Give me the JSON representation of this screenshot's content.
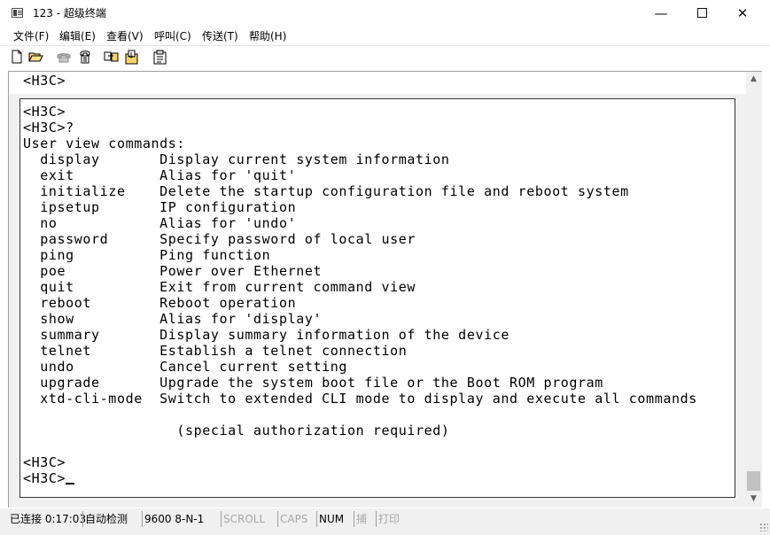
{
  "window": {
    "title": "123 - 超级终端",
    "minimize_glyph": "—",
    "close_glyph": "✕"
  },
  "menu": [
    "文件(F)",
    "编辑(E)",
    "查看(V)",
    "呼叫(C)",
    "传送(T)",
    "帮助(H)"
  ],
  "toolbar": {
    "icons": [
      "new-file-icon",
      "open-folder-icon",
      "call-icon",
      "disconnect-icon",
      "send-icon",
      "receive-icon",
      "properties-icon"
    ]
  },
  "terminal": {
    "top_line": "<H3C>",
    "prompt_lines": [
      "<H3C>",
      "<H3C>?"
    ],
    "header": "User view commands:",
    "commands": [
      {
        "cmd": "display",
        "desc": "Display current system information"
      },
      {
        "cmd": "exit",
        "desc": "Alias for 'quit'"
      },
      {
        "cmd": "initialize",
        "desc": "Delete the startup configuration file and reboot system"
      },
      {
        "cmd": "ipsetup",
        "desc": "IP configuration"
      },
      {
        "cmd": "no",
        "desc": "Alias for 'undo'"
      },
      {
        "cmd": "password",
        "desc": "Specify password of local user"
      },
      {
        "cmd": "ping",
        "desc": "Ping function"
      },
      {
        "cmd": "poe",
        "desc": "Power over Ethernet"
      },
      {
        "cmd": "quit",
        "desc": "Exit from current command view"
      },
      {
        "cmd": "reboot",
        "desc": "Reboot operation"
      },
      {
        "cmd": "show",
        "desc": "Alias for 'display'"
      },
      {
        "cmd": "summary",
        "desc": "Display summary information of the device"
      },
      {
        "cmd": "telnet",
        "desc": "Establish a telnet connection"
      },
      {
        "cmd": "undo",
        "desc": "Cancel current setting"
      },
      {
        "cmd": "upgrade",
        "desc": "Upgrade the system boot file or the Boot ROM program"
      },
      {
        "cmd": "xtd-cli-mode",
        "desc": "Switch to extended CLI mode to display and execute all commands"
      }
    ],
    "continuation": "(special authorization required)",
    "tail_lines": [
      "<H3C>",
      "<H3C>"
    ]
  },
  "status": {
    "connection": "已连接 0:17:03",
    "detect": "自动检测",
    "baud": "9600 8-N-1",
    "scroll": "SCROLL",
    "caps": "CAPS",
    "num": "NUM",
    "capture": "捕",
    "print": "打印"
  },
  "colors": {
    "window_bg": "#ffffff",
    "chrome_bg": "#f0f0f0",
    "dim_text": "#a8a8a8"
  }
}
